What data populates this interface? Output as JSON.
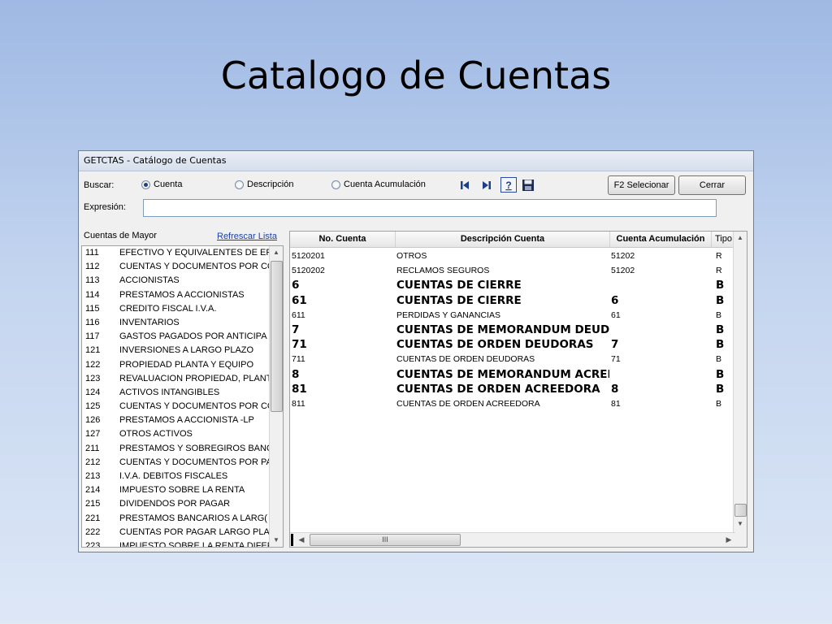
{
  "slide": {
    "title": "Catalogo de Cuentas"
  },
  "window": {
    "title": "GETCTAS - Catálogo de Cuentas",
    "buscar_label": "Buscar:",
    "radios": [
      {
        "label": "Cuenta",
        "selected": true
      },
      {
        "label": "Descripción",
        "selected": false
      },
      {
        "label": "Cuenta Acumulación",
        "selected": false
      }
    ],
    "buttons": {
      "select": "F2 Selecionar",
      "close": "Cerrar"
    },
    "expresion_label": "Expresión:",
    "expresion_value": "",
    "accent_color": "#1c3f86"
  },
  "left_panel": {
    "header": "Cuentas de Mayor",
    "refresh_link": "Refrescar Lista",
    "rows": [
      [
        "111",
        "EFECTIVO Y EQUIVALENTES DE EFI"
      ],
      [
        "112",
        "CUENTAS Y DOCUMENTOS POR CC"
      ],
      [
        "113",
        "ACCIONISTAS"
      ],
      [
        "114",
        "PRESTAMOS A ACCIONISTAS"
      ],
      [
        "115",
        "CREDITO FISCAL I.V.A."
      ],
      [
        "116",
        "INVENTARIOS"
      ],
      [
        "117",
        "GASTOS PAGADOS POR ANTICIPA"
      ],
      [
        "121",
        "INVERSIONES A LARGO PLAZO"
      ],
      [
        "122",
        "PROPIEDAD PLANTA Y EQUIPO"
      ],
      [
        "123",
        "REVALUACION PROPIEDAD, PLANT"
      ],
      [
        "124",
        "ACTIVOS INTANGIBLES"
      ],
      [
        "125",
        "CUENTAS Y DOCUMENTOS POR CC"
      ],
      [
        "126",
        "PRESTAMOS A ACCIONISTA -LP"
      ],
      [
        "127",
        "OTROS ACTIVOS"
      ],
      [
        "211",
        "PRESTAMOS Y SOBREGIROS BANC"
      ],
      [
        "212",
        "CUENTAS Y DOCUMENTOS POR PA"
      ],
      [
        "213",
        "I.V.A. DEBITOS FISCALES"
      ],
      [
        "214",
        "IMPUESTO SOBRE LA RENTA"
      ],
      [
        "215",
        "DIVIDENDOS POR PAGAR"
      ],
      [
        "221",
        "PRESTAMOS BANCARIOS A LARG("
      ],
      [
        "222",
        "CUENTAS POR PAGAR LARGO PLA"
      ],
      [
        "223",
        "IMPUESTO SOBRE LA RENTA DIFER"
      ]
    ]
  },
  "grid": {
    "headers": [
      "No. Cuenta",
      "Descripción Cuenta",
      "Cuenta Acumulación",
      "Tipo"
    ],
    "rows": [
      {
        "cuenta": "5120201",
        "desc": "OTROS",
        "acum": "51202",
        "tipo": "R",
        "bold": false
      },
      {
        "cuenta": "5120202",
        "desc": "RECLAMOS SEGUROS",
        "acum": "51202",
        "tipo": "R",
        "bold": false
      },
      {
        "cuenta": "6",
        "desc": "CUENTAS DE CIERRE",
        "acum": "",
        "tipo": "B",
        "bold": true
      },
      {
        "cuenta": "61",
        "desc": "CUENTAS DE CIERRE",
        "acum": "6",
        "tipo": "B",
        "bold": true
      },
      {
        "cuenta": "611",
        "desc": "PERDIDAS Y GANANCIAS",
        "acum": "61",
        "tipo": "B",
        "bold": false
      },
      {
        "cuenta": "7",
        "desc": "CUENTAS DE MEMORANDUM DEUDORA",
        "acum": "",
        "tipo": "B",
        "bold": true
      },
      {
        "cuenta": "71",
        "desc": "CUENTAS DE ORDEN DEUDORAS",
        "acum": "7",
        "tipo": "B",
        "bold": true
      },
      {
        "cuenta": "711",
        "desc": "CUENTAS DE ORDEN DEUDORAS",
        "acum": "71",
        "tipo": "B",
        "bold": false
      },
      {
        "cuenta": "8",
        "desc": "CUENTAS DE MEMORANDUM ACREEDO",
        "acum": "",
        "tipo": "B",
        "bold": true
      },
      {
        "cuenta": "81",
        "desc": "CUENTAS DE ORDEN ACREEDORA",
        "acum": "8",
        "tipo": "B",
        "bold": true
      },
      {
        "cuenta": "811",
        "desc": "CUENTAS DE ORDEN ACREEDORA",
        "acum": "81",
        "tipo": "B",
        "bold": false
      }
    ],
    "hscroll_grip": "III"
  }
}
